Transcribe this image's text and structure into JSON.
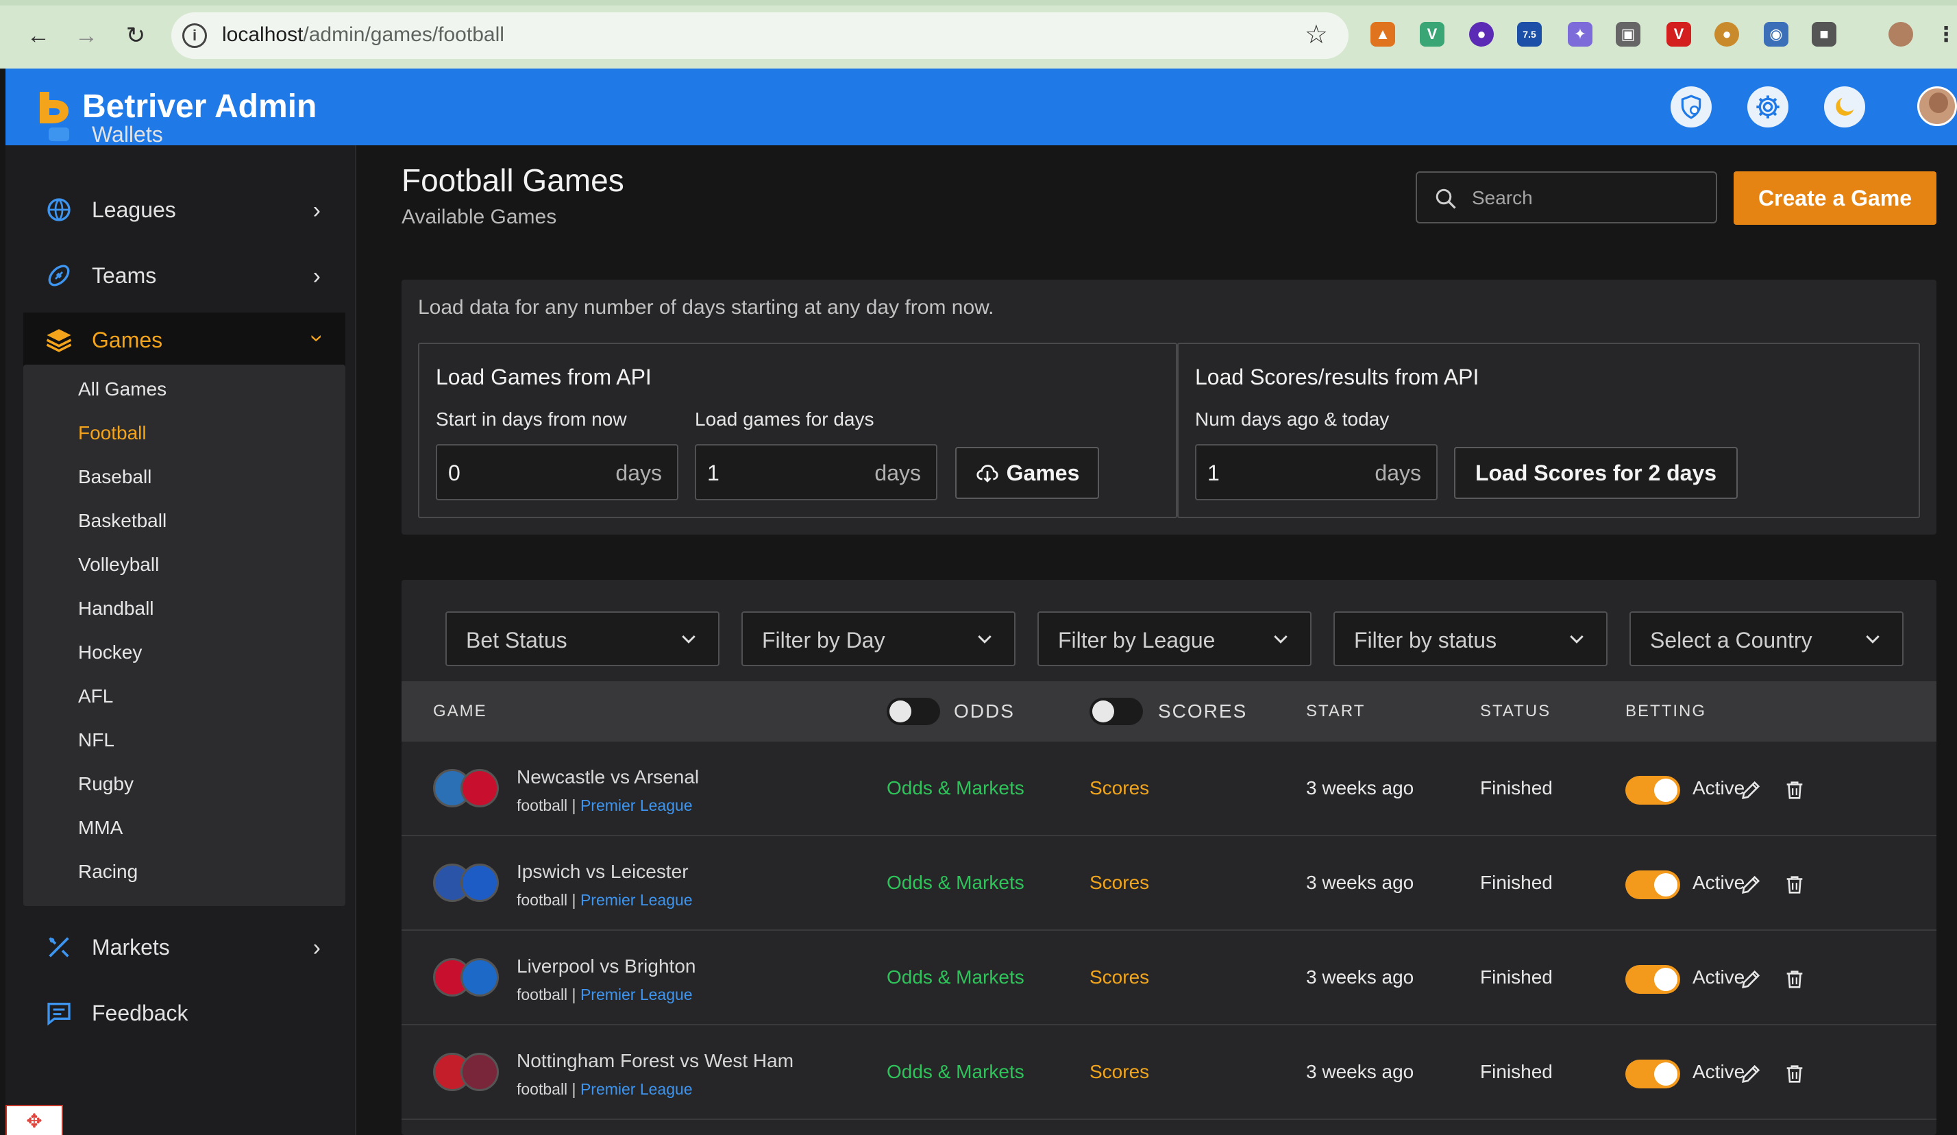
{
  "browser": {
    "url_host": "localhost",
    "url_path": "/admin/games/football",
    "extension_badge": "7.5"
  },
  "app": {
    "title": "Betriver Admin"
  },
  "sidebar": {
    "partial_top": "Wallets",
    "items": [
      {
        "label": "Leagues",
        "icon": "globe-icon"
      },
      {
        "label": "Teams",
        "icon": "football-icon"
      },
      {
        "label": "Games",
        "icon": "layers-icon"
      }
    ],
    "games_submenu": [
      "All Games",
      "Football",
      "Baseball",
      "Basketball",
      "Volleyball",
      "Handball",
      "Hockey",
      "AFL",
      "NFL",
      "Rugby",
      "MMA",
      "Racing"
    ],
    "active_sub": "Football",
    "bottom_items": [
      {
        "label": "Markets",
        "icon": "markets-icon"
      },
      {
        "label": "Feedback",
        "icon": "chat-icon"
      }
    ]
  },
  "page": {
    "title": "Football Games",
    "subtitle": "Available Games",
    "search_placeholder": "Search",
    "create_button": "Create a Game"
  },
  "load": {
    "intro": "Load data for any number of days starting at any day from now.",
    "games_box": {
      "title": "Load Games from API",
      "start_label": "Start in days from now",
      "start_value": "0",
      "days_label": "Load games for days",
      "days_value": "1",
      "unit": "days",
      "button": "Games"
    },
    "scores_box": {
      "title": "Load Scores/results from API",
      "label": "Num days ago & today",
      "value": "1",
      "unit": "days",
      "button": "Load Scores for 2 days"
    }
  },
  "filters": [
    "Bet Status",
    "Filter by Day",
    "Filter by League",
    "Filter by status",
    "Select a Country"
  ],
  "table": {
    "headers": {
      "game": "GAME",
      "odds": "ODDS",
      "scores": "SCORES",
      "start": "START",
      "status": "STATUS",
      "betting": "BETTING"
    },
    "rows": [
      {
        "name": "Newcastle vs Arsenal",
        "sport": "football",
        "league": "Premier League",
        "odds": "Odds & Markets",
        "scores": "Scores",
        "start": "3 weeks ago",
        "status": "Finished",
        "betting": "Active",
        "colors": [
          "#2b6fb5",
          "#c8102e"
        ]
      },
      {
        "name": "Ipswich vs Leicester",
        "sport": "football",
        "league": "Premier League",
        "odds": "Odds & Markets",
        "scores": "Scores",
        "start": "3 weeks ago",
        "status": "Finished",
        "betting": "Active",
        "colors": [
          "#2a54a8",
          "#1d5cc4"
        ]
      },
      {
        "name": "Liverpool vs Brighton",
        "sport": "football",
        "league": "Premier League",
        "odds": "Odds & Markets",
        "scores": "Scores",
        "start": "3 weeks ago",
        "status": "Finished",
        "betting": "Active",
        "colors": [
          "#c8102e",
          "#1c69c8"
        ]
      },
      {
        "name": "Nottingham Forest vs West Ham",
        "sport": "football",
        "league": "Premier League",
        "odds": "Odds & Markets",
        "scores": "Scores",
        "start": "3 weeks ago",
        "status": "Finished",
        "betting": "Active",
        "colors": [
          "#c41e2a",
          "#7a263a"
        ]
      }
    ]
  },
  "colors": {
    "accent": "#e58412",
    "header": "#1f7ae8",
    "odds": "#2ec45a",
    "scores": "#f0a51c",
    "league_link": "#3d95f0"
  }
}
